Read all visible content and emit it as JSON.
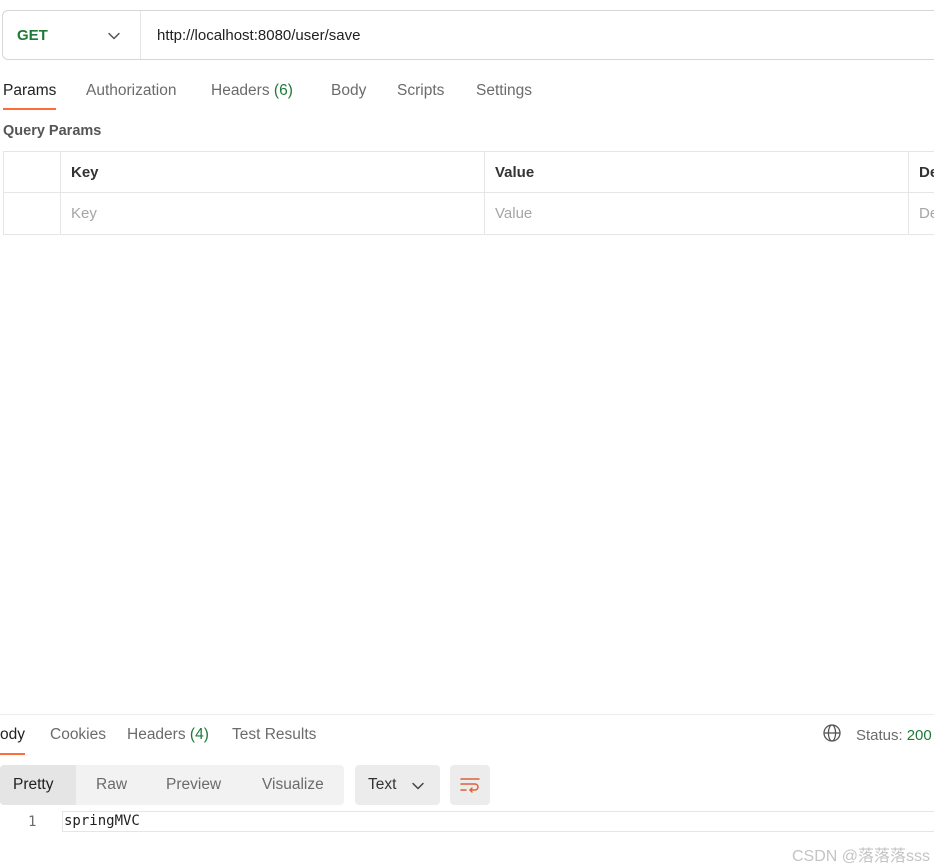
{
  "request": {
    "method": "GET",
    "url": "http://localhost:8080/user/save"
  },
  "request_tabs": [
    {
      "label": "Params"
    },
    {
      "label": "Authorization"
    },
    {
      "label": "Headers",
      "count": "(6)"
    },
    {
      "label": "Body"
    },
    {
      "label": "Scripts"
    },
    {
      "label": "Settings"
    }
  ],
  "query_params": {
    "title": "Query Params",
    "columns": [
      "Key",
      "Value",
      "De"
    ],
    "placeholder_row": [
      "Key",
      "Value",
      "De"
    ]
  },
  "response": {
    "tabs": [
      {
        "label": "ody"
      },
      {
        "label": "Cookies"
      },
      {
        "label": "Headers",
        "count": "(4)"
      },
      {
        "label": "Test Results"
      }
    ],
    "status_label": "Status:",
    "status_value": "200",
    "view_modes": [
      "Pretty",
      "Raw",
      "Preview",
      "Visualize"
    ],
    "format": "Text",
    "body_lines": [
      {
        "num": "1",
        "text": "springMVC"
      }
    ]
  },
  "icons": {
    "method_dropdown": "chevron-down-icon",
    "format_dropdown": "chevron-down-icon",
    "wrap": "word-wrap-icon",
    "network": "globe-icon"
  },
  "colors": {
    "accent": "#ff6c37",
    "get_method": "#1f7a37",
    "status_ok": "#1f7a37"
  },
  "watermark": "CSDN @落落落sss"
}
